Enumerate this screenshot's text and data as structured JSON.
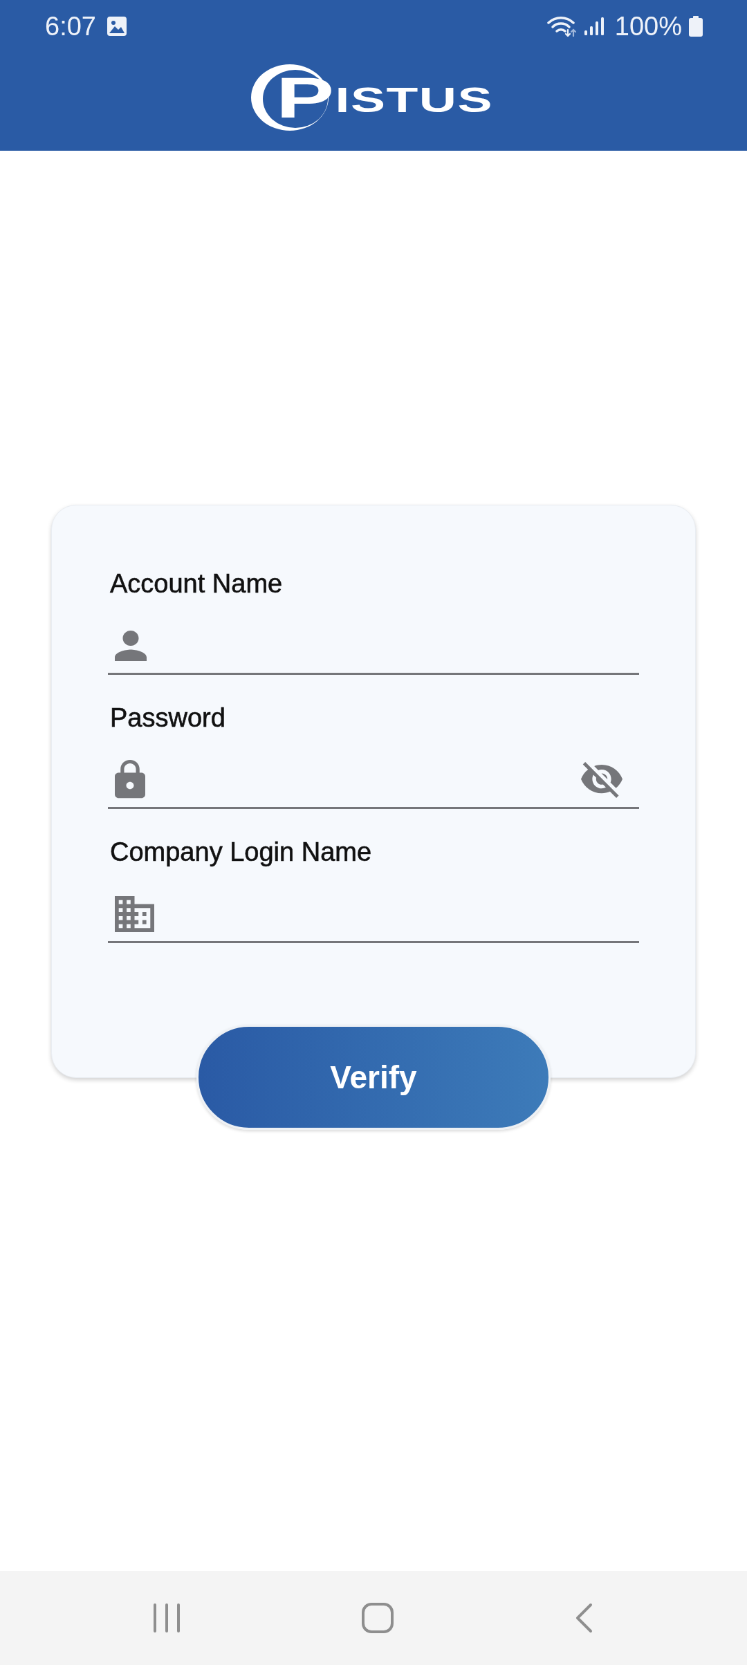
{
  "status_bar": {
    "time": "6:07",
    "battery": "100%"
  },
  "header": {
    "logo": "PISTUS"
  },
  "form": {
    "fields": [
      {
        "kind": "account",
        "label": "Account Name"
      },
      {
        "kind": "password",
        "label": "Password",
        "masked": true
      },
      {
        "kind": "company",
        "label": "Company Login Name"
      }
    ],
    "submit": "Verify"
  }
}
